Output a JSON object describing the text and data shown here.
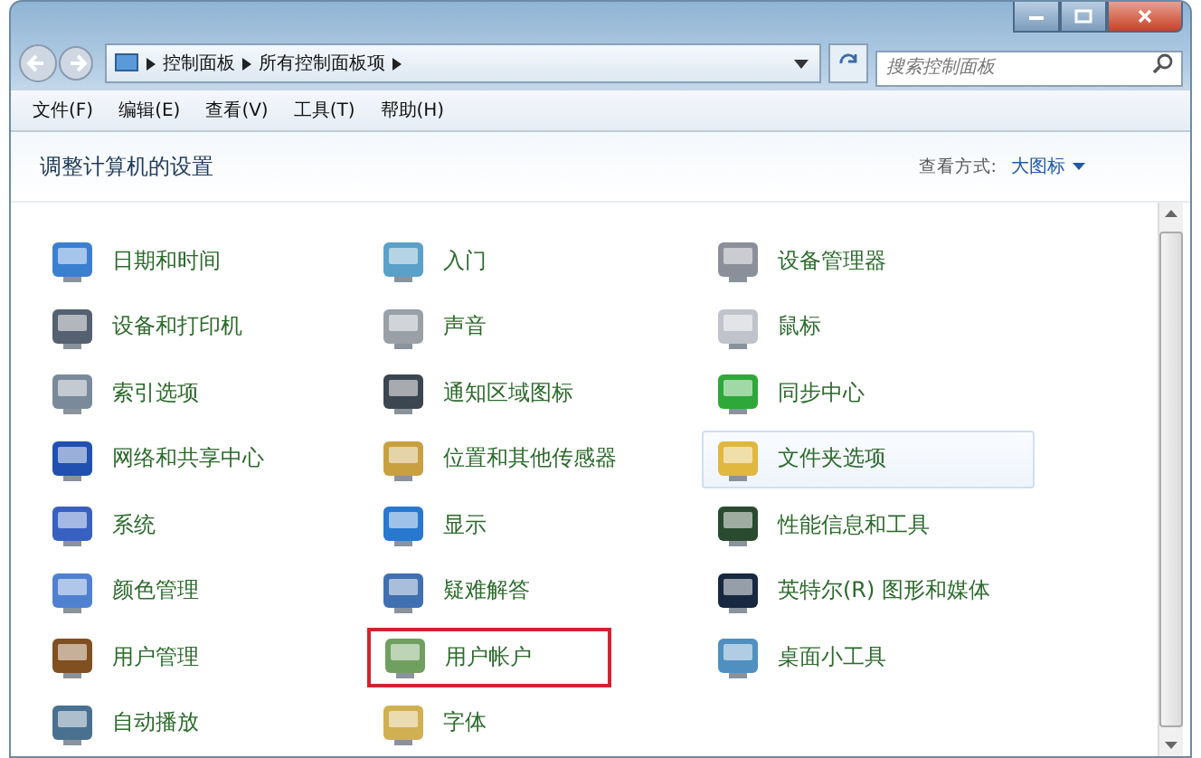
{
  "address_bar": {
    "crumbs": [
      "控制面板",
      "所有控制面板项"
    ]
  },
  "search": {
    "placeholder": "搜索控制面板"
  },
  "menu": [
    "文件(F)",
    "编辑(E)",
    "查看(V)",
    "工具(T)",
    "帮助(H)"
  ],
  "header": {
    "title": "调整计算机的设置",
    "view_label": "查看方式:",
    "view_value": "大图标"
  },
  "items": [
    {
      "label": "日期和时间",
      "selected": false,
      "outlined": false
    },
    {
      "label": "入门",
      "selected": false,
      "outlined": false
    },
    {
      "label": "设备管理器",
      "selected": false,
      "outlined": false
    },
    {
      "label": "设备和打印机",
      "selected": false,
      "outlined": false
    },
    {
      "label": "声音",
      "selected": false,
      "outlined": false
    },
    {
      "label": "鼠标",
      "selected": false,
      "outlined": false
    },
    {
      "label": "索引选项",
      "selected": false,
      "outlined": false
    },
    {
      "label": "通知区域图标",
      "selected": false,
      "outlined": false
    },
    {
      "label": "同步中心",
      "selected": false,
      "outlined": false
    },
    {
      "label": "网络和共享中心",
      "selected": false,
      "outlined": false
    },
    {
      "label": "位置和其他传感器",
      "selected": false,
      "outlined": false
    },
    {
      "label": "文件夹选项",
      "selected": true,
      "outlined": false
    },
    {
      "label": "系统",
      "selected": false,
      "outlined": false
    },
    {
      "label": "显示",
      "selected": false,
      "outlined": false
    },
    {
      "label": "性能信息和工具",
      "selected": false,
      "outlined": false
    },
    {
      "label": "颜色管理",
      "selected": false,
      "outlined": false
    },
    {
      "label": "疑难解答",
      "selected": false,
      "outlined": false
    },
    {
      "label": "英特尔(R) 图形和媒体",
      "selected": false,
      "outlined": false
    },
    {
      "label": "用户管理",
      "selected": false,
      "outlined": false
    },
    {
      "label": "用户帐户",
      "selected": false,
      "outlined": true
    },
    {
      "label": "桌面小工具",
      "selected": false,
      "outlined": false
    },
    {
      "label": "自动播放",
      "selected": false,
      "outlined": false
    },
    {
      "label": "字体",
      "selected": false,
      "outlined": false
    }
  ]
}
